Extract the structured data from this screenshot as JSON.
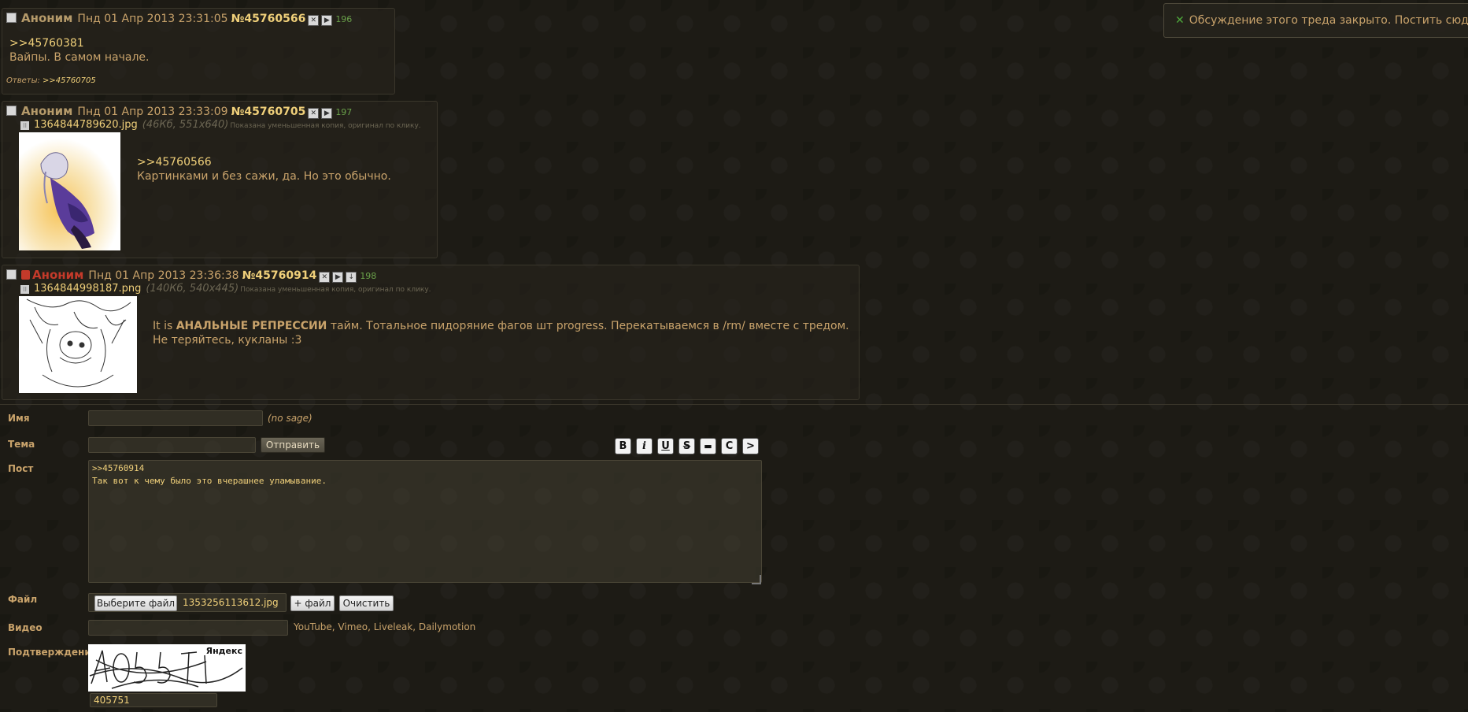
{
  "notice": {
    "text": "Обсуждение этого треда закрыто. Постить сюда нельзя."
  },
  "posts": [
    {
      "name": "Аноним",
      "date": "Пнд 01 Апр 2013 23:31:05",
      "num": "№45760566",
      "count": "196",
      "ref": ">>45760381",
      "text": "Вайпы. В самом начале.",
      "replies_label": "Ответы:",
      "replies_ref": ">>45760705"
    },
    {
      "name": "Аноним",
      "date": "Пнд 01 Апр 2013 23:33:09",
      "num": "№45760705",
      "count": "197",
      "file_name": "1364844789620.jpg",
      "file_meta": "(46Кб, 551x640)",
      "file_note": "Показана уменьшенная копия, оригинал по клику.",
      "ref": ">>45760566",
      "text": "Картинками и без сажи, да. Но это обычно."
    },
    {
      "name": "Аноним",
      "date": "Пнд 01 Апр 2013 23:36:38",
      "num": "№45760914",
      "count": "198",
      "file_name": "1364844998187.png",
      "file_meta": "(140Кб, 540x445)",
      "file_note": "Показана уменьшенная копия, оригинал по клику.",
      "text_pre": "It is ",
      "text_bold": "АНАЛЬНЫЕ РЕПРЕССИИ",
      "text_post": " тайм. Тотальное пидоряние фагов шт progress. Перекатываемся в /rm/ вместе с тредом.",
      "text_line2": "Не теряйтесь, кукланы :3"
    }
  ],
  "form": {
    "name_label": "Имя",
    "no_sage": "(no sage)",
    "subject_label": "Тема",
    "submit_label": "Отправить",
    "post_label": "Пост",
    "post_value": ">>45760914\nТак вот к чему было это вчерашнее уламывание.",
    "format_buttons": [
      "B",
      "i",
      "U",
      "S",
      "▬",
      "C",
      ">"
    ],
    "file_label": "Файл",
    "choose_file_label": "Выберите файл",
    "chosen_file": "1353256113612.jpg",
    "add_file_label": "+ файл",
    "clear_label": "Очистить",
    "video_label": "Видео",
    "video_hint": "YouTube, Vimeo, Liveleak, Dailymotion",
    "captcha_label": "Подтверждение",
    "captcha_brand": "Яндекс",
    "captcha_value": "405751"
  },
  "colors": {
    "background": "#1d1b15",
    "text": "#c9a36b",
    "link": "#f0d07a",
    "counter": "#6aa14a",
    "name_red": "#c43a2a"
  }
}
